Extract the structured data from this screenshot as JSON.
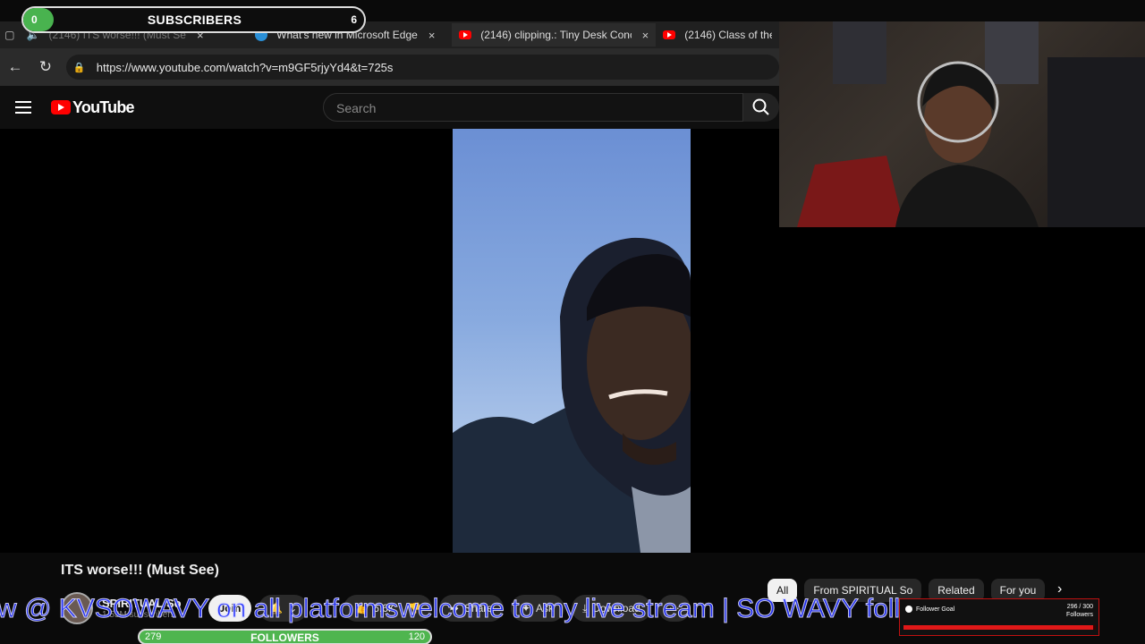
{
  "browser": {
    "tabs": [
      {
        "title": "(2146) ITS worse!!! (Must Se",
        "close": "×"
      },
      {
        "title": "What's new in Microsoft Edge",
        "close": "×"
      },
      {
        "title": "(2146) clipping.: Tiny Desk Conce",
        "close": "×"
      },
      {
        "title": "(2146) Class of the Ti",
        "close": ""
      }
    ],
    "url": "https://www.youtube.com/watch?v=m9GF5rjyYd4&t=725s"
  },
  "youtube": {
    "logo_text": "YouTube",
    "search_placeholder": "Search"
  },
  "video": {
    "title": "ITS worse!!! (Must See)",
    "channel_name": "SPIRITUAL So",
    "channel_subs": "1.53M subscribers",
    "actions": {
      "join": "Join",
      "likes": "6.6K",
      "share": "Share",
      "ask": "Ask",
      "download": "Download"
    }
  },
  "chips": [
    "All",
    "From SPIRITUAL So",
    "Related",
    "For you"
  ],
  "overlays": {
    "subscribers": {
      "label": "SUBSCRIBERS",
      "current": "0",
      "goal": "6",
      "progress": 0
    },
    "followers": {
      "label": "FOLLOWERS",
      "current": "279",
      "goal": "120",
      "progress": 1
    },
    "ticker": "w @ KVSOWAVY on all platformswelcome to my live stream | SO WAVY follo",
    "follower_goal": {
      "title": "Follower Goal",
      "value": "296 / 300",
      "unit": "Followers",
      "progress": 0.987
    }
  },
  "colors": {
    "youtube_red": "#ff0000",
    "goal_green": "#49b34f",
    "ticker_blue": "#1f2eff"
  }
}
